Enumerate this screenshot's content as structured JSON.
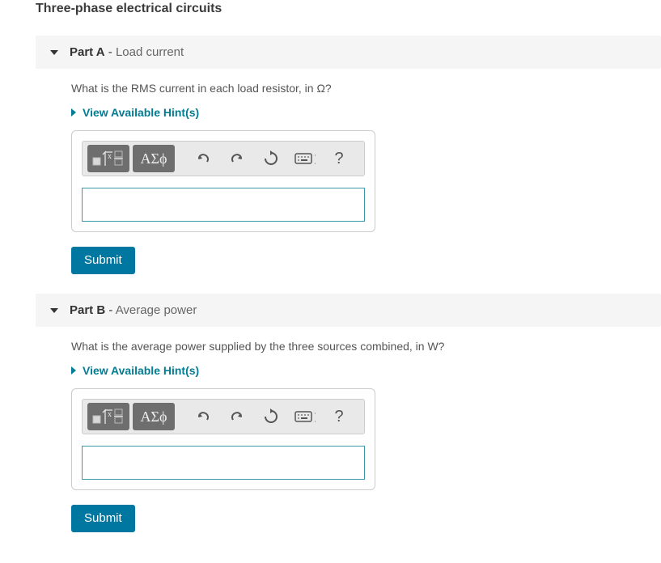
{
  "title": "Three-phase electrical circuits",
  "hints_label": "View Available Hint(s)",
  "submit_label": "Submit",
  "symbols_button_label": "ΑΣϕ",
  "keyboard_label": "⌨ ]",
  "help_label": "?",
  "parts": {
    "a": {
      "label_bold": "Part A",
      "dash": " - ",
      "subtitle": "Load current",
      "prompt": "What is the RMS current in each load resistor, in Ω?",
      "value": ""
    },
    "b": {
      "label_bold": "Part B",
      "dash": " - ",
      "subtitle": "Average power",
      "prompt": "What is the average power supplied by the three sources combined, in W?",
      "value": ""
    }
  }
}
